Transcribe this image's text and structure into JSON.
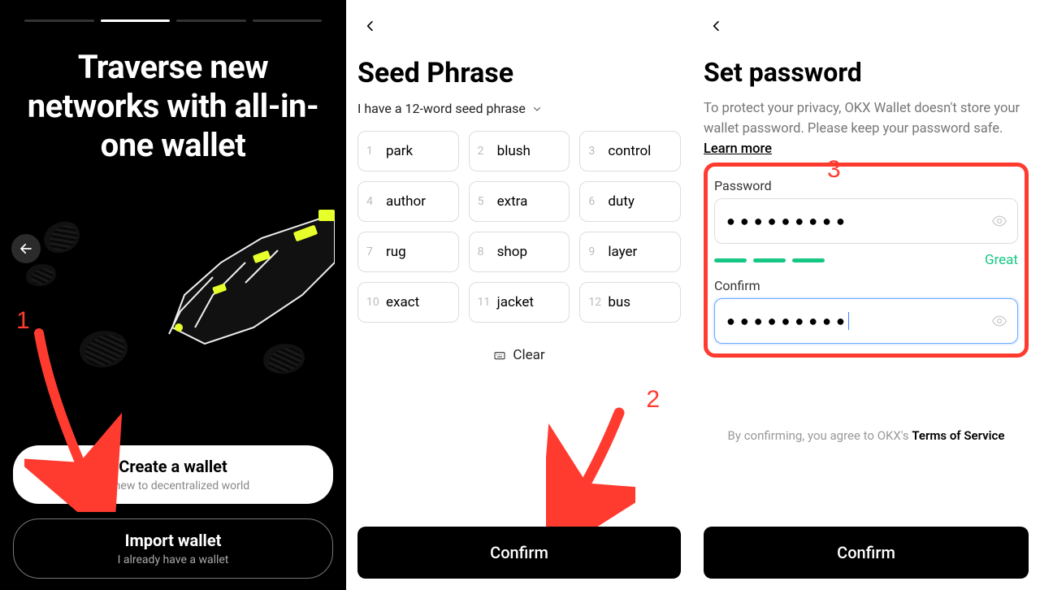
{
  "annotations": {
    "n1": "1",
    "n2": "2",
    "n3": "3"
  },
  "pane1": {
    "headline": "Traverse new networks with all-in-one wallet",
    "create": {
      "title": "Create a wallet",
      "sub": "I'm new to decentralized world"
    },
    "import": {
      "title": "Import wallet",
      "sub": "I already have a wallet"
    }
  },
  "pane2": {
    "title": "Seed Phrase",
    "selector": "I have a 12-word seed phrase",
    "words": [
      "park",
      "blush",
      "control",
      "author",
      "extra",
      "duty",
      "rug",
      "shop",
      "layer",
      "exact",
      "jacket",
      "bus"
    ],
    "clear": "Clear",
    "confirm": "Confirm"
  },
  "pane3": {
    "title": "Set password",
    "desc_pre": "To protect your privacy, OKX Wallet doesn't store your wallet password. Please keep your password safe.  ",
    "learn": "Learn more",
    "password_label": "Password",
    "password_mask": "●●●●●●●●●",
    "strength": "Great",
    "confirm_label": "Confirm",
    "confirm_mask": "●●●●●●●●●",
    "agree_pre": "By confirming, you agree to OKX's ",
    "agree_link": "Terms of Service",
    "confirm_btn": "Confirm"
  }
}
